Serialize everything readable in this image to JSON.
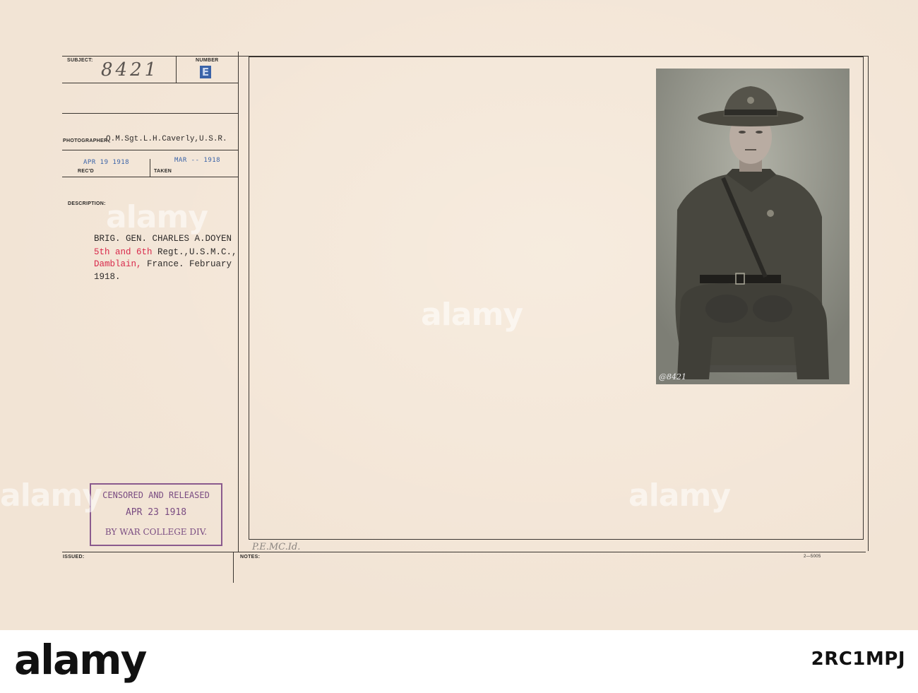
{
  "card": {
    "subject_label": "SUBJECT:",
    "subject_number": "8421",
    "number_label": "NUMBER",
    "number_mark": "E",
    "photographer_label": "PHOTOGRAPHER",
    "photographer": "Q.M.Sgt.L.H.Caverly,U.S.R.",
    "received_date": "APR 19 1918",
    "received_label": "REC'D",
    "taken_date": "MAR -- 1918",
    "taken_label": "TAKEN",
    "description_label": "DESCRIPTION:",
    "description_line1": "BRIG. GEN. CHARLES A.DOYEN",
    "description_line2_red": "5th and 6th",
    "description_line2_rest": " Regt.,U.S.M.C.,",
    "description_line3_red": "Damblain,",
    "description_line3_rest": " France. February",
    "description_line4": "1918.",
    "censor_line1": "CENSORED AND RELEASED",
    "censor_line2": "APR 23 1918",
    "censor_line3": "BY WAR COLLEGE DIV.",
    "issued_label": "ISSUED:",
    "notes_label": "NOTES:",
    "notes_hand": "P.E.MC.Id.",
    "form_number": "2—5005",
    "photo_caption": "@8421"
  },
  "watermark": {
    "text": "alamy"
  },
  "footer": {
    "brand": "alamy",
    "image_id": "2RC1MPJ"
  }
}
